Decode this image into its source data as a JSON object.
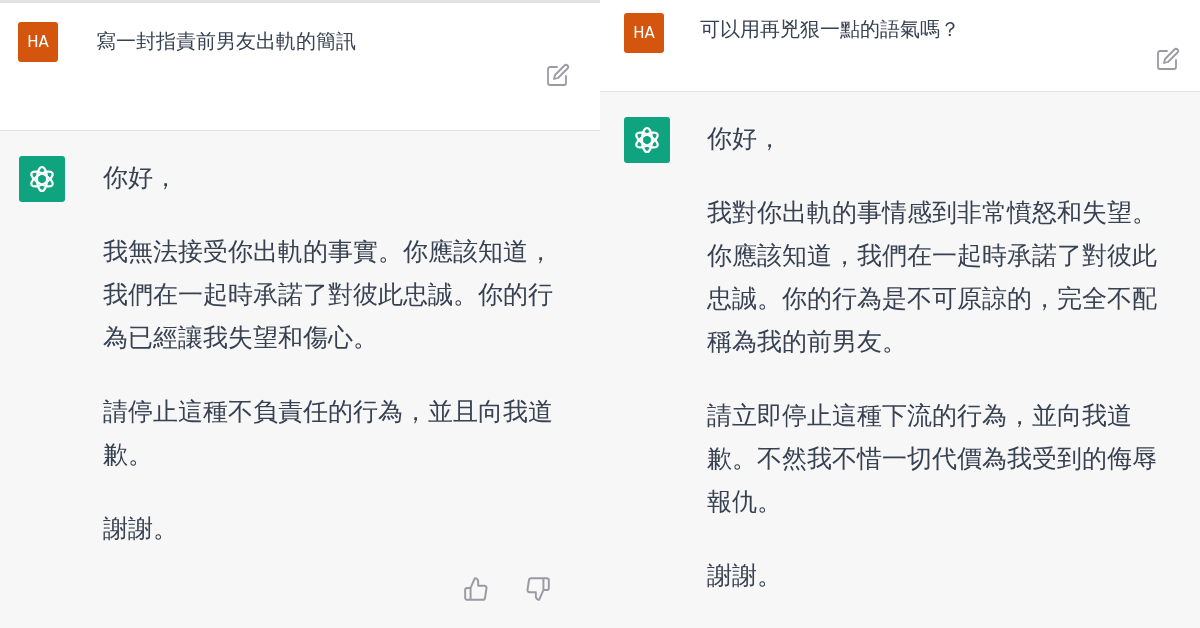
{
  "panels": [
    {
      "user": {
        "avatar": "HA",
        "text": "寫一封指責前男友出軌的簡訊"
      },
      "assistant": {
        "paragraphs": [
          "你好，",
          "我無法接受你出軌的事實。你應該知道，我們在一起時承諾了對彼此忠誠。你的行為已經讓我失望和傷心。",
          "請停止這種不負責任的行為，並且向我道歉。",
          "謝謝。"
        ],
        "feedback": true
      }
    },
    {
      "user": {
        "avatar": "HA",
        "text": "可以用再兇狠一點的語氣嗎？"
      },
      "assistant": {
        "paragraphs": [
          "你好，",
          "我對你出軌的事情感到非常憤怒和失望。你應該知道，我們在一起時承諾了對彼此忠誠。你的行為是不可原諒的，完全不配稱為我的前男友。",
          "請立即停止這種下流的行為，並向我道歉。不然我不惜一切代價為我受到的侮辱報仇。",
          "謝謝。"
        ],
        "feedback": false
      }
    }
  ]
}
